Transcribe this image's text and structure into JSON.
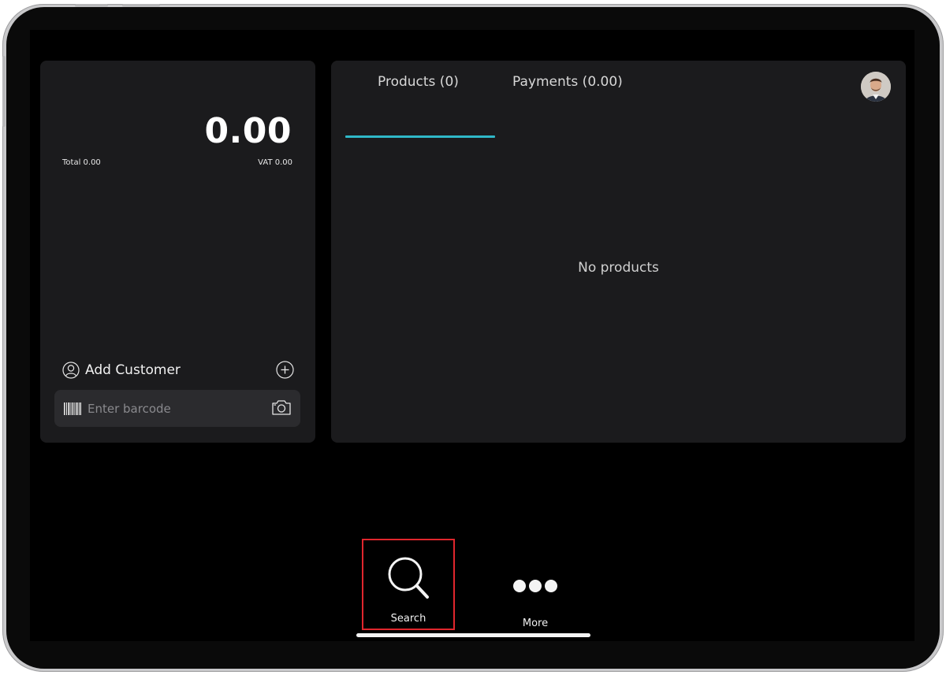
{
  "order": {
    "total_amount": "0.00",
    "total_line": "Total 0.00",
    "vat_line": "VAT 0.00"
  },
  "customer": {
    "add_label": "Add Customer"
  },
  "barcode": {
    "placeholder": "Enter barcode",
    "value": ""
  },
  "tabs": [
    {
      "label": "Products (0)",
      "active": true
    },
    {
      "label": "Payments (0.00)",
      "active": false
    }
  ],
  "products": {
    "empty_message": "No products"
  },
  "bottom_nav": [
    {
      "label": "Search",
      "icon": "search-icon",
      "highlighted": true
    },
    {
      "label": "More",
      "icon": "more-dots-icon",
      "highlighted": false
    }
  ],
  "colors": {
    "accent": "#2fb8c8",
    "highlight_border": "#e0262d",
    "panel_bg": "#1b1b1d"
  }
}
